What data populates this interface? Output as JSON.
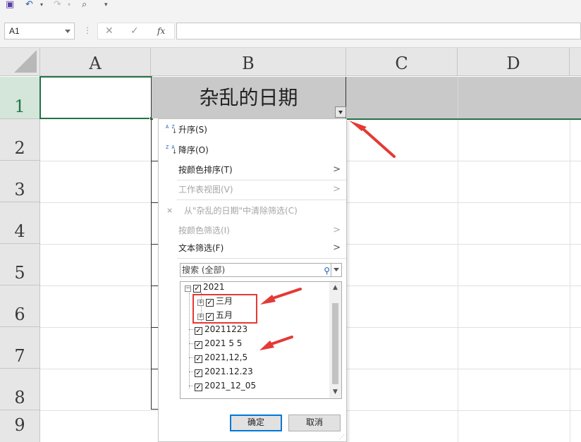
{
  "name_box": {
    "value": "A1"
  },
  "formula_bar": {
    "fx_label": "fx",
    "value": ""
  },
  "columns": [
    "A",
    "B",
    "C",
    "D"
  ],
  "rows": [
    "1",
    "2",
    "3",
    "4",
    "5",
    "6",
    "7",
    "8",
    "9"
  ],
  "cells": {
    "B1": "杂乱的日期"
  },
  "filter_menu": {
    "sort_ascending": "升序(S)",
    "sort_descending": "降序(O)",
    "sort_by_color": "按颜色排序(T)",
    "sheet_view": "工作表视图(V)",
    "clear_filter": "从\"杂乱的日期\"中清除筛选(C)",
    "filter_by_color": "按颜色筛选(I)",
    "text_filter": "文本筛选(F)",
    "search_placeholder": "搜索 (全部)",
    "tree": [
      {
        "label": "2021",
        "checked": true,
        "level": 0,
        "expander": "minus"
      },
      {
        "label": "三月",
        "checked": true,
        "level": 1,
        "expander": "plus"
      },
      {
        "label": "五月",
        "checked": true,
        "level": 1,
        "expander": "plus"
      },
      {
        "label": "20211223",
        "checked": true,
        "level": 0
      },
      {
        "label": "2021 5 5",
        "checked": true,
        "level": 0
      },
      {
        "label": "2021,12,5",
        "checked": true,
        "level": 0
      },
      {
        "label": "2021.12.23",
        "checked": true,
        "level": 0
      },
      {
        "label": "2021_12_05",
        "checked": true,
        "level": 0
      }
    ],
    "ok_label": "确定",
    "cancel_label": "取消",
    "sort_icon_asc": "A Z",
    "sort_icon_desc": "Z A"
  },
  "colors": {
    "accent_green": "#217346",
    "annotation_red": "#e53935",
    "header_fill": "#c9c9c9"
  }
}
